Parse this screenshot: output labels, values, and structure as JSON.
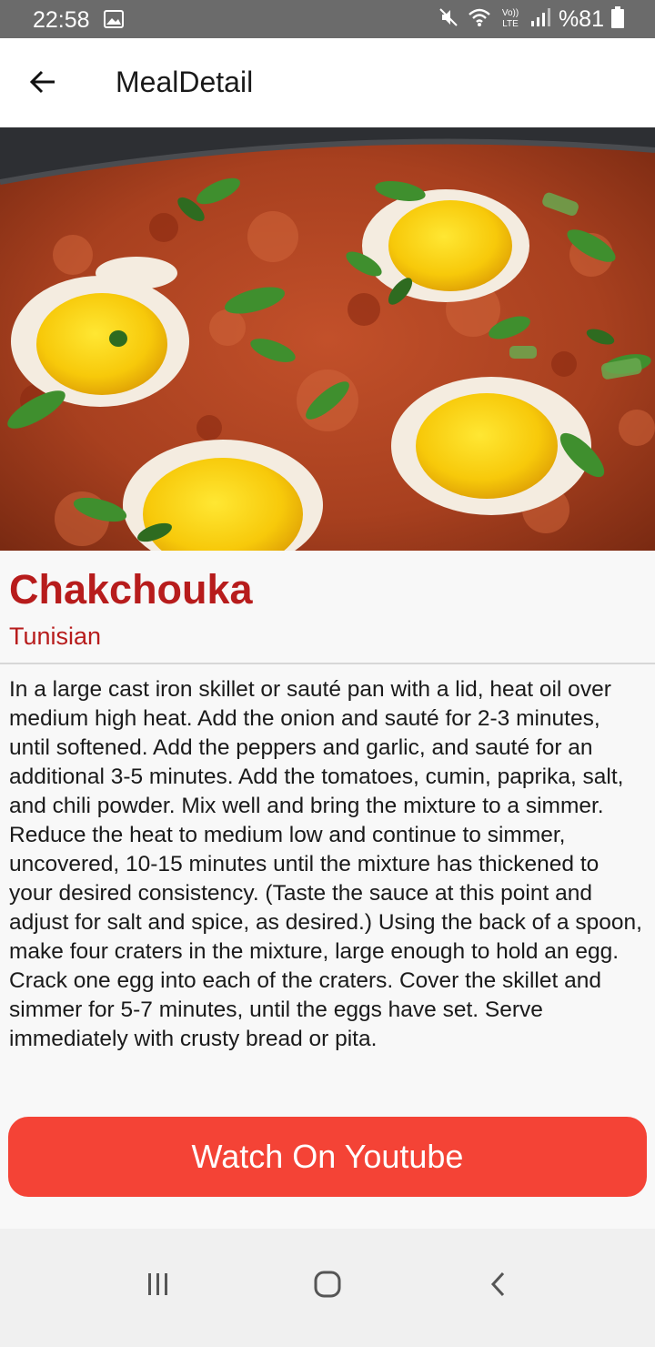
{
  "status_bar": {
    "time": "22:58",
    "battery": "%81",
    "icons": [
      "gallery-icon",
      "mute-icon",
      "wifi-icon",
      "volte-lte-icon",
      "signal-icon",
      "battery-icon"
    ]
  },
  "app_bar": {
    "back_icon": "arrow-left-icon",
    "title": "MealDetail"
  },
  "meal": {
    "image": "meal-photo",
    "name": "Chakchouka",
    "area": "Tunisian",
    "instructions": "In a large cast iron skillet or sauté pan with a lid, heat oil over medium high heat. Add the onion and sauté for 2-3 minutes, until softened. Add the peppers and garlic, and sauté for an additional 3-5 minutes. Add the tomatoes, cumin, paprika, salt, and chili powder. Mix well and bring the mixture to a simmer. Reduce the heat to medium low and continue to simmer, uncovered, 10-15 minutes until the mixture has thickened to your desired consistency. (Taste the sauce at this point and adjust for salt and spice, as desired.) Using the back of a spoon, make four craters in the mixture, large enough to hold an egg. Crack one egg into each of the craters. Cover the skillet and simmer for 5-7 minutes, until the eggs have set. Serve immediately with crusty bread or pita."
  },
  "actions": {
    "watch_label": "Watch On Youtube"
  },
  "nav_bar": {
    "icons": [
      "recent-apps-icon",
      "home-icon",
      "back-icon"
    ]
  },
  "colors": {
    "accent_red": "#b71c1c",
    "button_red": "#f44336",
    "status_bar": "#6b6b6b"
  }
}
